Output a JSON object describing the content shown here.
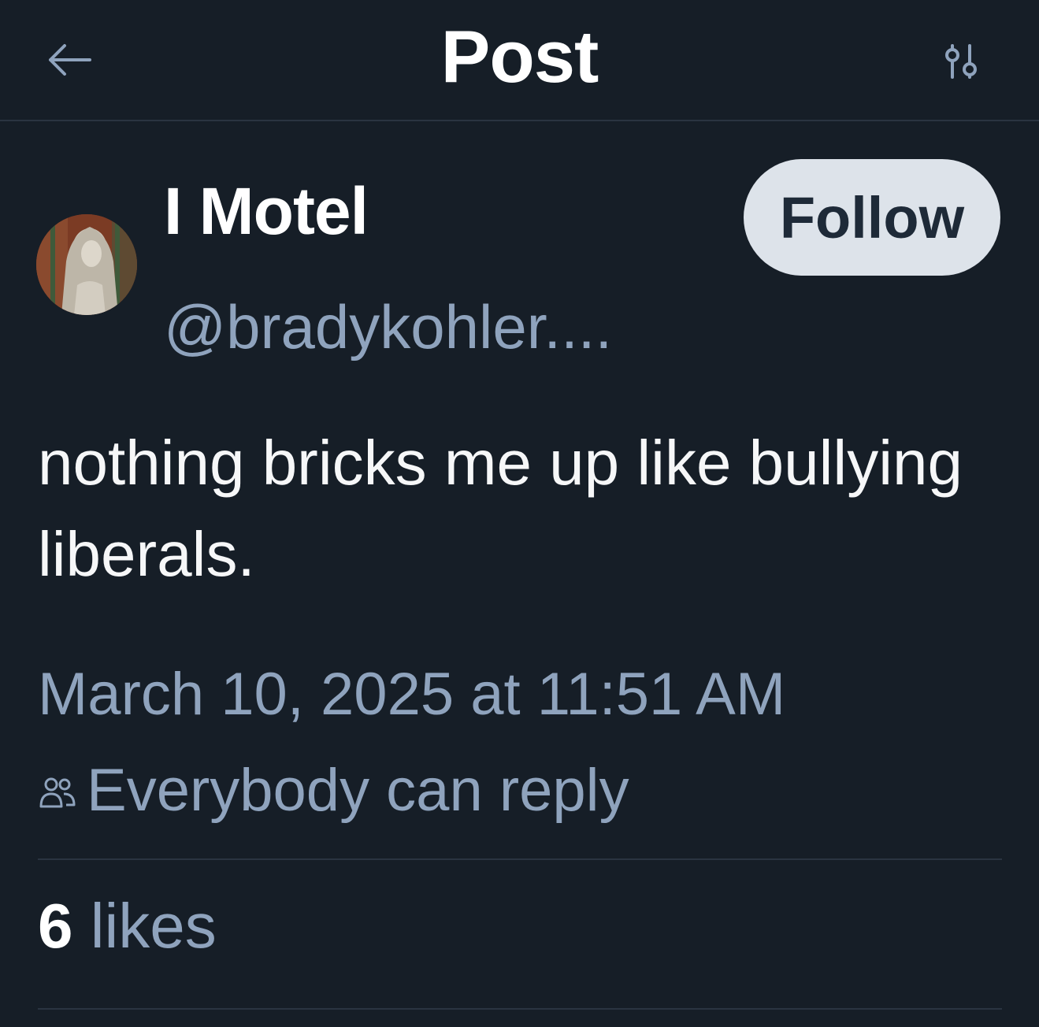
{
  "header": {
    "title": "Post",
    "back_icon": "arrow-left-icon",
    "filter_icon": "sliders-icon"
  },
  "author": {
    "display_name": "I Motel",
    "handle": "@bradykohler....",
    "follow_label": "Follow"
  },
  "post": {
    "text": "nothing bricks me up like bullying liberals.",
    "timestamp": "March 10, 2025 at 11:51 AM",
    "reply_setting": "Everybody can reply",
    "reply_icon": "people-icon"
  },
  "stats": {
    "likes_count": "6",
    "likes_label": "likes"
  },
  "colors": {
    "background": "#161e27",
    "muted_text": "#8fa3bd",
    "follow_bg": "#dde3ea"
  }
}
